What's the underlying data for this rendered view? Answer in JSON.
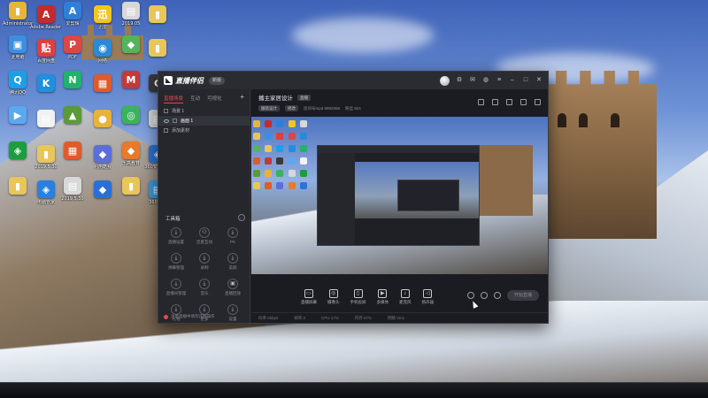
{
  "desktop": {
    "icons": [
      {
        "label": "Administrator",
        "color": "#e8b43a",
        "glyph": "▮"
      },
      {
        "label": "Adobe Reader XI",
        "color": "#c42b2b",
        "glyph": "A"
      },
      {
        "label": "爱剪辑",
        "color": "#2d7fd8",
        "glyph": "A"
      },
      {
        "label": "迅雷",
        "color": "#f3c522",
        "glyph": "迅"
      },
      {
        "label": "2019.05",
        "color": "#d8d8d8",
        "glyph": "▤"
      },
      {
        "label": "",
        "color": "#e8c65a",
        "glyph": "▮"
      },
      {
        "label": "此电脑",
        "color": "#3b8fe0",
        "glyph": "▣"
      },
      {
        "label": "百度网盘",
        "color": "#e23d3d",
        "glyph": "贴"
      },
      {
        "label": "PDF",
        "color": "#d94848",
        "glyph": "P"
      },
      {
        "label": "网络",
        "color": "#2a8ad8",
        "glyph": "◉"
      },
      {
        "label": "",
        "color": "#55b35b",
        "glyph": "◆"
      },
      {
        "label": "",
        "color": "#e8c65a",
        "glyph": "▮"
      },
      {
        "label": "腾讯QQ",
        "color": "#1aa0e8",
        "glyph": "Q"
      },
      {
        "label": "",
        "color": "#1f8fe0",
        "glyph": "K"
      },
      {
        "label": "",
        "color": "#21b26b",
        "glyph": "N"
      },
      {
        "label": "",
        "color": "#e05a2a",
        "glyph": "▦"
      },
      {
        "label": "",
        "color": "#c23a3a",
        "glyph": "M"
      },
      {
        "label": "",
        "color": "#3a3a3a",
        "glyph": "C"
      },
      {
        "label": "",
        "color": "#5aa9f0",
        "glyph": "▶"
      },
      {
        "label": "",
        "color": "#f2f2f2",
        "glyph": "▤"
      },
      {
        "label": "",
        "color": "#5a9a3a",
        "glyph": "▲"
      },
      {
        "label": "",
        "color": "#e8b33a",
        "glyph": "●"
      },
      {
        "label": "",
        "color": "#3bb35b",
        "glyph": "◎"
      },
      {
        "label": "",
        "color": "#d8d8d8",
        "glyph": "▤"
      },
      {
        "label": "",
        "color": "#1b9e3b",
        "glyph": "◈"
      },
      {
        "label": "2019.5.30",
        "color": "#e8c65a",
        "glyph": "▮"
      },
      {
        "label": "",
        "color": "#e05a2a",
        "glyph": "▦"
      },
      {
        "label": "利用酷我",
        "color": "#5a6fd8",
        "glyph": "◆"
      },
      {
        "label": "乐高教育",
        "color": "#e87a2a",
        "glyph": "◆"
      },
      {
        "label": "360安全卫士",
        "color": "#2a73d8",
        "glyph": "◈"
      },
      {
        "label": "",
        "color": "#e8c65a",
        "glyph": "▮"
      },
      {
        "label": "电脑管家",
        "color": "#2b7fe0",
        "glyph": "◈"
      },
      {
        "label": "2019.5.30",
        "color": "#d8d8d8",
        "glyph": "▤"
      },
      {
        "label": "",
        "color": "#2a6fd8",
        "glyph": "◆"
      },
      {
        "label": "",
        "color": "#e8c65a",
        "glyph": "▮"
      },
      {
        "label": "360文档",
        "color": "#3a9ae0",
        "glyph": "▤"
      }
    ]
  },
  "app": {
    "brand_name": "直播伴侣",
    "version_label": "新版",
    "sidebar": {
      "tabs": [
        "直播场景",
        "互动",
        "可视化"
      ],
      "active_tab_index": 0,
      "scenes": [
        {
          "label": "场景 1",
          "selected": false
        },
        {
          "label": "画面 1",
          "selected": true
        },
        {
          "label": "添加素材",
          "selected": false
        }
      ],
      "toolbox_title": "工具箱",
      "tools": [
        {
          "label": "直播设置",
          "glyph": "⤓"
        },
        {
          "label": "连麦互动",
          "glyph": "⚇"
        },
        {
          "label": "PK",
          "glyph": "⤓"
        },
        {
          "label": "弹幕管理",
          "glyph": "⤓"
        },
        {
          "label": "录制",
          "glyph": "⤓"
        },
        {
          "label": "美颜",
          "glyph": "⤓"
        },
        {
          "label": "直播间管理",
          "glyph": "⤓"
        },
        {
          "label": "音乐",
          "glyph": "⤓"
        },
        {
          "label": "直播回放",
          "glyph": "▣"
        },
        {
          "label": "礼物",
          "glyph": "⤓"
        },
        {
          "label": "更多",
          "glyph": "⤓"
        },
        {
          "label": "设置",
          "glyph": "⤓"
        }
      ],
      "footer_text": "注意直播中请勿违规操作"
    },
    "room": {
      "title": "播主家居设计",
      "badge": "直播",
      "category_chip": "服装设计",
      "edit_chip": "修改",
      "room_id": "房间号mpd 9982558",
      "fans_label": "粉丝 824"
    },
    "bottom_tools": [
      {
        "label": "直播屏幕",
        "glyph": "▭"
      },
      {
        "label": "摄像头",
        "glyph": "◎"
      },
      {
        "label": "手机投屏",
        "glyph": "▯"
      },
      {
        "label": "多媒体",
        "glyph": "▶"
      },
      {
        "label": "麦克风",
        "glyph": "♪"
      },
      {
        "label": "扬声器",
        "glyph": "◁"
      }
    ],
    "start_live_label": "开始直播",
    "status": [
      "码率 0kbps",
      "帧率 0",
      "CPU 17%",
      "内存 57%",
      "网络 0ms"
    ]
  }
}
